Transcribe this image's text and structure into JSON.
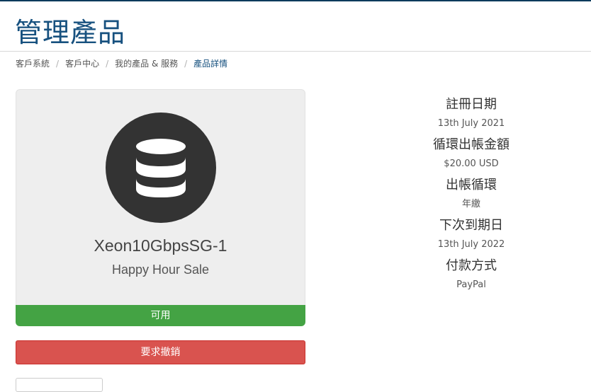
{
  "page": {
    "title": "管理產品"
  },
  "breadcrumb": {
    "items": [
      "客戶系統",
      "客戶中心",
      "我的產品 & 服務"
    ],
    "active": "產品詳情"
  },
  "product": {
    "icon": "database-icon",
    "name": "Xeon10GbpsSG-1",
    "group": "Happy Hour Sale",
    "status": "可用",
    "cancel_label": "要求撤銷"
  },
  "details": [
    {
      "label": "註冊日期",
      "value": "13th July 2021"
    },
    {
      "label": "循環出帳金額",
      "value": "$20.00 USD"
    },
    {
      "label": "出帳循環",
      "value": "年繳"
    },
    {
      "label": "下次到期日",
      "value": "13th July 2022"
    },
    {
      "label": "付款方式",
      "value": "PayPal"
    }
  ],
  "colors": {
    "title": "#17517f",
    "status_active": "#44a344",
    "danger": "#d9534f",
    "card_bg": "#eeeeee",
    "icon_bg": "#333333"
  }
}
